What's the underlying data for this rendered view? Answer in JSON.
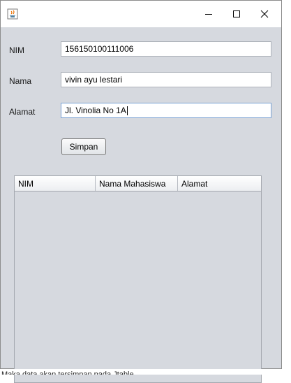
{
  "window": {
    "icon": "java-app-icon",
    "controls": [
      "minimize-icon",
      "maximize-icon",
      "close-icon"
    ]
  },
  "form": {
    "nim_label": "NIM",
    "nim_value": "156150100111006",
    "nama_label": "Nama",
    "nama_value": "vivin ayu lestari",
    "alamat_label": "Alamat",
    "alamat_value": "Jl. Vinolia No 1A",
    "save_label": "Simpan"
  },
  "table": {
    "columns": [
      "NIM",
      "Nama Mahasiswa",
      "Alamat"
    ],
    "rows": []
  },
  "caption": "Maka data akan tersimpan pada Jtable"
}
